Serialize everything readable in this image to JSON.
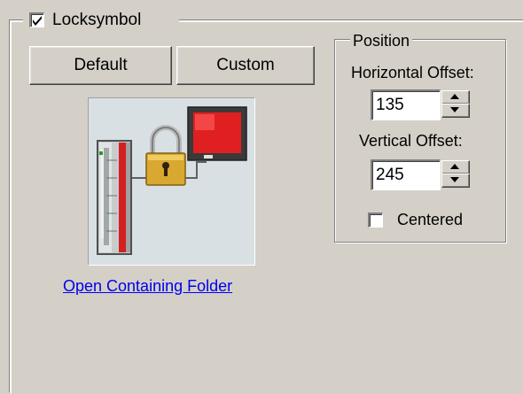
{
  "lock_group": {
    "checkbox_label": "Locksymbol",
    "checkbox_checked": true,
    "default_button": "Default",
    "custom_button": "Custom",
    "open_folder_link": "Open Containing Folder"
  },
  "position": {
    "title": "Position",
    "horizontal_label": "Horizontal Offset:",
    "horizontal_value": "135",
    "vertical_label": "Vertical Offset:",
    "vertical_value": "245",
    "centered_label": "Centered",
    "centered_checked": false
  },
  "icons": {
    "lock": "lock-icon",
    "plc": "plc-device-icon",
    "monitor": "monitor-icon"
  }
}
